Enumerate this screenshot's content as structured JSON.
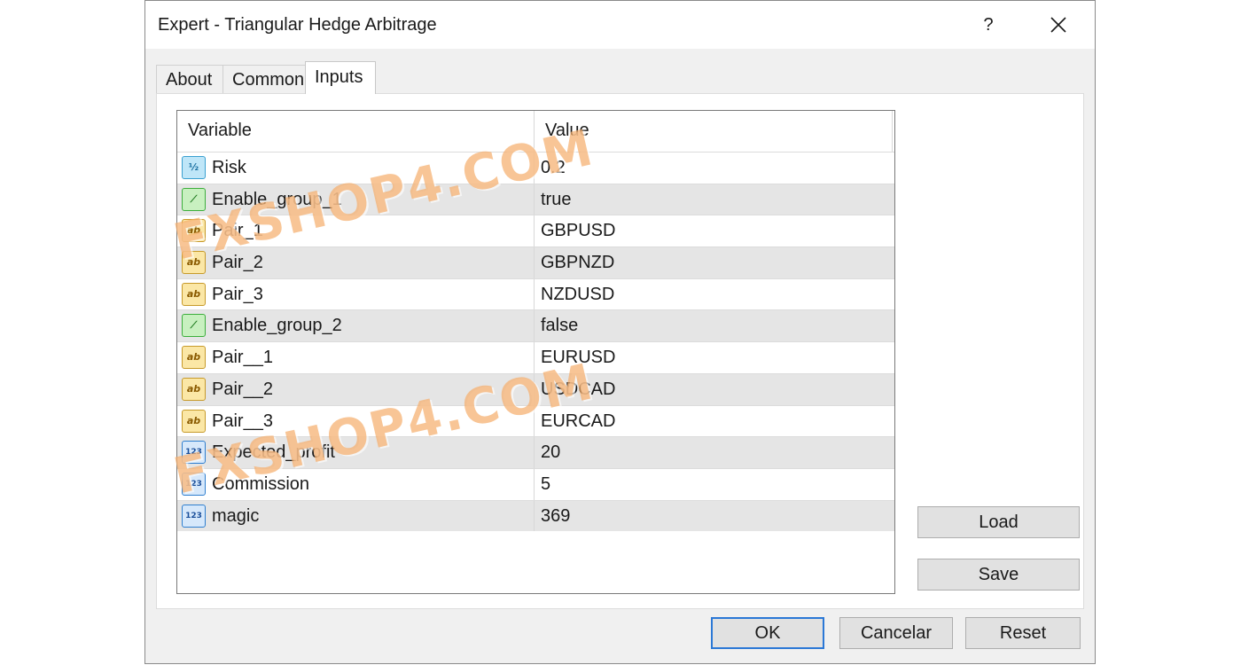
{
  "window": {
    "title": "Expert - Triangular Hedge Arbitrage",
    "help_label": "?"
  },
  "tabs": [
    {
      "label": "About",
      "active": false
    },
    {
      "label": "Common",
      "active": false
    },
    {
      "label": "Inputs",
      "active": true
    }
  ],
  "grid": {
    "columns": [
      "Variable",
      "Value"
    ],
    "rows": [
      {
        "variable": "Risk",
        "value": "0.2",
        "icon": "fraction-icon",
        "icon_text": "½"
      },
      {
        "variable": "Enable_group_1",
        "value": "true",
        "icon": "boolean-icon",
        "icon_text": "⟋"
      },
      {
        "variable": "Pair_1",
        "value": "GBPUSD",
        "icon": "string-icon",
        "icon_text": "ab"
      },
      {
        "variable": "Pair_2",
        "value": "GBPNZD",
        "icon": "string-icon",
        "icon_text": "ab"
      },
      {
        "variable": "Pair_3",
        "value": "NZDUSD",
        "icon": "string-icon",
        "icon_text": "ab"
      },
      {
        "variable": "Enable_group_2",
        "value": "false",
        "icon": "boolean-icon",
        "icon_text": "⟋"
      },
      {
        "variable": "Pair__1",
        "value": "EURUSD",
        "icon": "string-icon",
        "icon_text": "ab"
      },
      {
        "variable": "Pair__2",
        "value": "USDCAD",
        "icon": "string-icon",
        "icon_text": "ab"
      },
      {
        "variable": "Pair__3",
        "value": "EURCAD",
        "icon": "string-icon",
        "icon_text": "ab"
      },
      {
        "variable": "Expected_profit",
        "value": "20",
        "icon": "integer-icon",
        "icon_text": "123"
      },
      {
        "variable": "Commission",
        "value": "5",
        "icon": "integer-icon",
        "icon_text": "123"
      },
      {
        "variable": "magic",
        "value": "369",
        "icon": "integer-icon",
        "icon_text": "123"
      }
    ]
  },
  "side_buttons": {
    "load": "Load",
    "save": "Save"
  },
  "footer_buttons": {
    "ok": "OK",
    "cancel": "Cancelar",
    "reset": "Reset"
  },
  "watermark": "FXSHOP4.COM",
  "colors": {
    "accent": "#2b78d6",
    "row_alt": "#e5e5e5",
    "watermark": "#f5af6e"
  }
}
